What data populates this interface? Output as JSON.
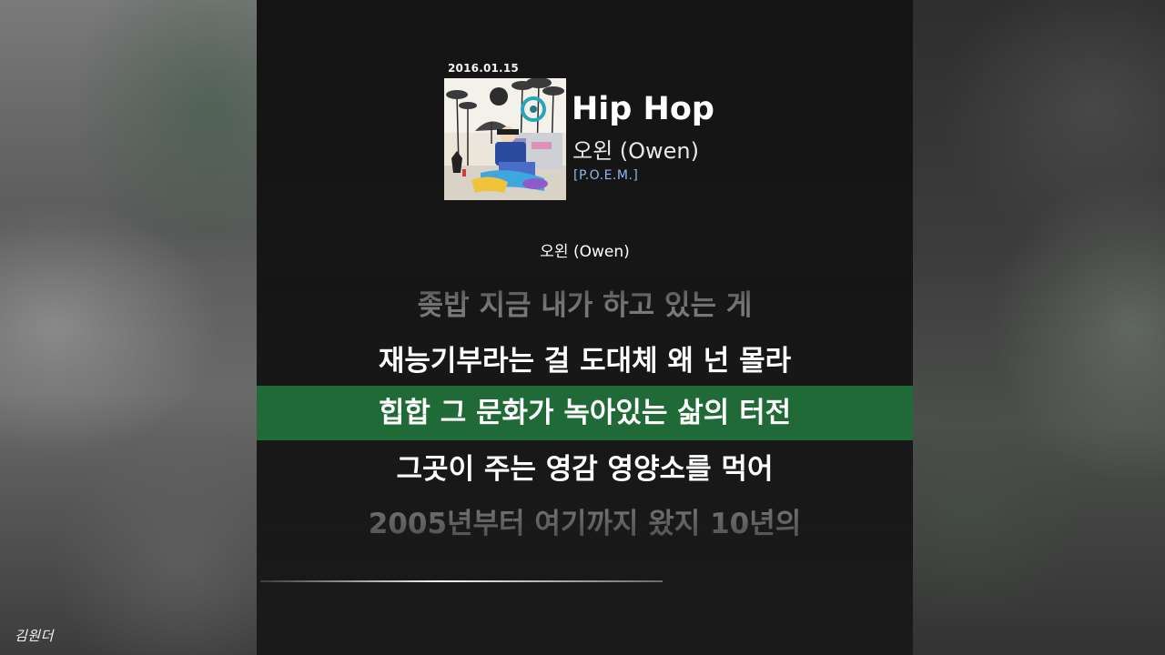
{
  "release_date": "2016.01.15",
  "track": {
    "title": "Hip Hop",
    "artist": "오왼 (Owen)",
    "album": "[P.O.E.M.]"
  },
  "singer_label": "오왼 (Owen)",
  "lyrics": [
    {
      "text": "좆밥 지금 내가 하고 있는 게",
      "state": "past"
    },
    {
      "text": "재능기부라는 걸 도대체 왜 넌 몰라",
      "state": "previous"
    },
    {
      "text": "힙합 그 문화가 녹아있는 삶의 터전",
      "state": "current"
    },
    {
      "text": "그곳이 주는 영감 영양소를 먹어",
      "state": "next"
    },
    {
      "text": "2005년부터 여기까지 왔지 10년의",
      "state": "upcoming"
    }
  ],
  "progress_fraction": 0.62,
  "colors": {
    "highlight": "#1f6a36",
    "album_text": "#8fb6f0",
    "background": "#161616"
  },
  "watermark": "김원더"
}
